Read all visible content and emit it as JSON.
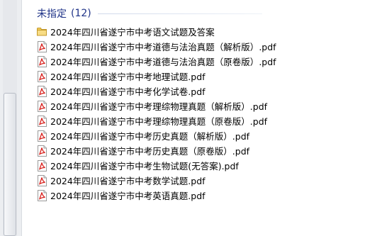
{
  "group": {
    "title": "未指定",
    "count": "(12)"
  },
  "files": [
    {
      "name": "2024年四川省遂宁市中考语文试题及答案",
      "icon": "folder-icon"
    },
    {
      "name": "2024年四川省遂宁市中考道德与法治真题（解析版）.pdf",
      "icon": "pdf-icon"
    },
    {
      "name": "2024年四川省遂宁市中考道德与法治真题（原卷版）.pdf",
      "icon": "pdf-icon"
    },
    {
      "name": "2024年四川省遂宁市中考地理试题.pdf",
      "icon": "pdf-icon"
    },
    {
      "name": "2024年四川省遂宁市中考化学试卷.pdf",
      "icon": "pdf-icon"
    },
    {
      "name": "2024年四川省遂宁市中考理综物理真题（解析版）.pdf",
      "icon": "pdf-icon"
    },
    {
      "name": "2024年四川省遂宁市中考理综物理真题（原卷版）.pdf",
      "icon": "pdf-icon"
    },
    {
      "name": "2024年四川省遂宁市中考历史真题（解析版）.pdf",
      "icon": "pdf-icon"
    },
    {
      "name": "2024年四川省遂宁市中考历史真题（原卷版）.pdf",
      "icon": "pdf-icon"
    },
    {
      "name": "2024年四川省遂宁市中考生物试题(无答案).pdf",
      "icon": "pdf-icon"
    },
    {
      "name": "2024年四川省遂宁市中考数学试题.pdf",
      "icon": "pdf-icon"
    },
    {
      "name": "2024年四川省遂宁市中考英语真题.pdf",
      "icon": "pdf-icon"
    }
  ],
  "colors": {
    "header_text": "#1e3287",
    "pdf_red": "#d8201c",
    "folder_yellow": "#f2cd5c"
  }
}
